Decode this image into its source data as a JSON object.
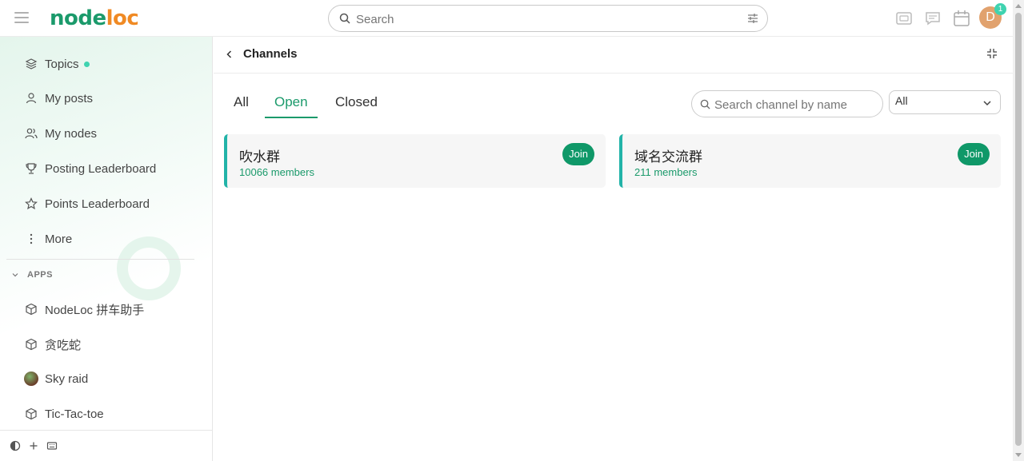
{
  "header": {
    "logo_part1": "node",
    "logo_part2": "loc",
    "search_placeholder": "Search",
    "avatar_letter": "D",
    "notification_count": "1",
    "icons": [
      "menu-icon",
      "search-icon",
      "filter-icon",
      "ad-icon",
      "chat-icon",
      "calendar-icon"
    ]
  },
  "sidebar": {
    "items": [
      {
        "label": "Topics",
        "icon": "layers-icon"
      },
      {
        "label": "My posts",
        "icon": "user-icon"
      },
      {
        "label": "My nodes",
        "icon": "users-icon"
      },
      {
        "label": "Posting Leaderboard",
        "icon": "trophy-icon"
      },
      {
        "label": "Points Leaderboard",
        "icon": "star-icon"
      },
      {
        "label": "More",
        "icon": "more-icon"
      }
    ],
    "apps_header": "APPS",
    "apps": [
      {
        "label": "NodeLoc 拼车助手",
        "icon": "cube-icon"
      },
      {
        "label": "贪吃蛇",
        "icon": "cube-icon"
      },
      {
        "label": "Sky raid",
        "icon": "sky-raid-avatar"
      },
      {
        "label": "Tic-Tac-toe",
        "icon": "cube-icon"
      }
    ]
  },
  "main": {
    "title": "Channels",
    "tabs": [
      {
        "label": "All",
        "active": false
      },
      {
        "label": "Open",
        "active": true
      },
      {
        "label": "Closed",
        "active": false
      }
    ],
    "channel_search_placeholder": "Search channel by name",
    "filter_selected": "All",
    "channels": [
      {
        "name": "吹水群",
        "members": "10066 members",
        "join_label": "Join"
      },
      {
        "name": "域名交流群",
        "members": "211 members",
        "join_label": "Join"
      }
    ]
  },
  "colors": {
    "brand_green": "#1b9a6b",
    "brand_orange": "#f08a24",
    "join_button": "#0f9868",
    "card_accent": "#22b3a8",
    "online_dot": "#3fd3b0"
  }
}
